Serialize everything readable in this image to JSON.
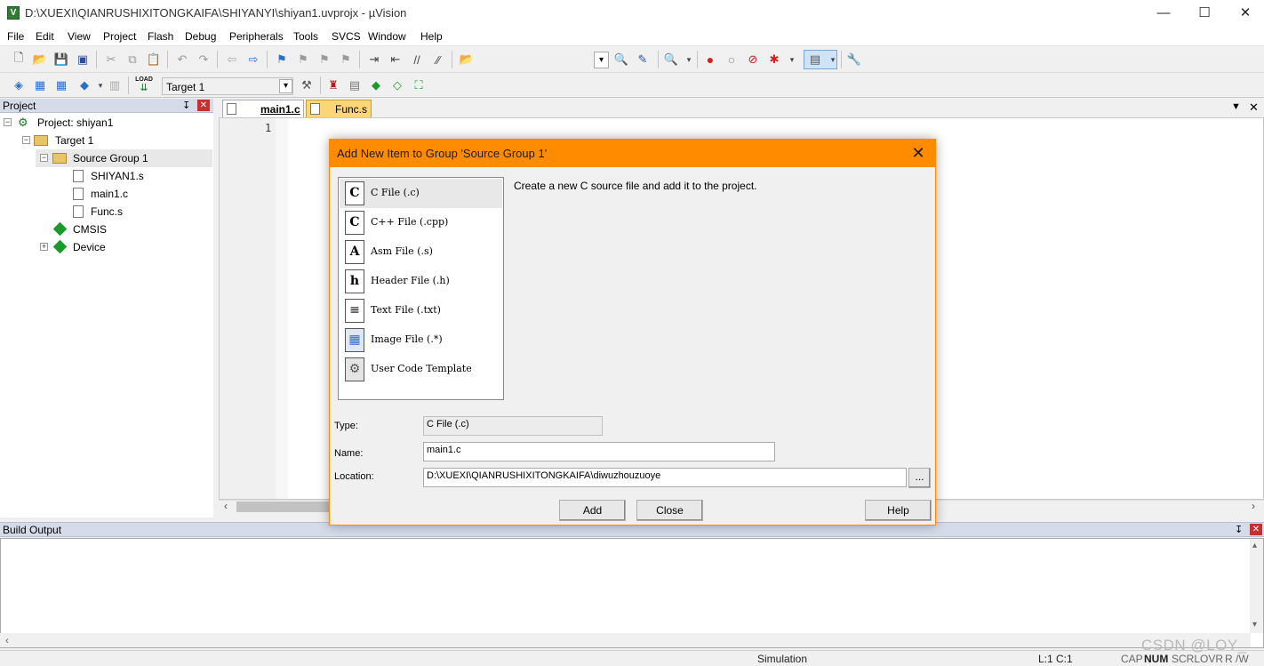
{
  "window": {
    "title": "D:\\XUEXI\\QIANRUSHIXITONGKAIFA\\SHIYANYI\\shiyan1.uvprojx - µVision",
    "minimize": "—",
    "maximize": "☐",
    "close": "✕"
  },
  "menu": [
    "File",
    "Edit",
    "View",
    "Project",
    "Flash",
    "Debug",
    "Peripherals",
    "Tools",
    "SVCS",
    "Window",
    "Help"
  ],
  "toolbar2": {
    "target_select": "Target 1",
    "load_label": "LOAD"
  },
  "project_panel": {
    "title": "Project",
    "pin": "↧",
    "close": "✕",
    "tree": {
      "project": "Project: shiyan1",
      "target": "Target 1",
      "group": "Source Group 1",
      "files": [
        "SHIYAN1.s",
        "main1.c",
        "Func.s"
      ],
      "cmsis": "CMSIS",
      "device": "Device"
    }
  },
  "editor": {
    "tabs": [
      "main1.c",
      "Func.s"
    ],
    "line_numbers": [
      "1"
    ]
  },
  "build_output": {
    "title": "Build Output"
  },
  "status": {
    "mode": "Simulation",
    "position": "L:1 C:1",
    "indicators": [
      "CAP",
      "NUM",
      "SCRL",
      "OVR",
      "R /W"
    ]
  },
  "dialog": {
    "title": "Add New Item to Group 'Source Group 1'",
    "close": "✕",
    "items": [
      {
        "glyph": "C",
        "label": "C File (.c)"
      },
      {
        "glyph": "C",
        "label": "C++ File (.cpp)"
      },
      {
        "glyph": "A",
        "label": "Asm File (.s)"
      },
      {
        "glyph": "h",
        "label": "Header File (.h)"
      },
      {
        "glyph": "≡",
        "label": "Text File (.txt)"
      },
      {
        "glyph": "▦",
        "label": "Image File (.*)"
      },
      {
        "glyph": "⚙",
        "label": "User Code Template"
      }
    ],
    "description": "Create a new C source file and add it to the project.",
    "type_label": "Type:",
    "type_value": "C File (.c)",
    "name_label": "Name:",
    "name_value": "main1.c",
    "location_label": "Location:",
    "location_value": "D:\\XUEXI\\QIANRUSHIXITONGKAIFA\\diwuzhouzuoye",
    "browse_label": "...",
    "add_label": "Add",
    "close_label": "Close",
    "help_label": "Help"
  },
  "watermark": "CSDN @LOY​_"
}
